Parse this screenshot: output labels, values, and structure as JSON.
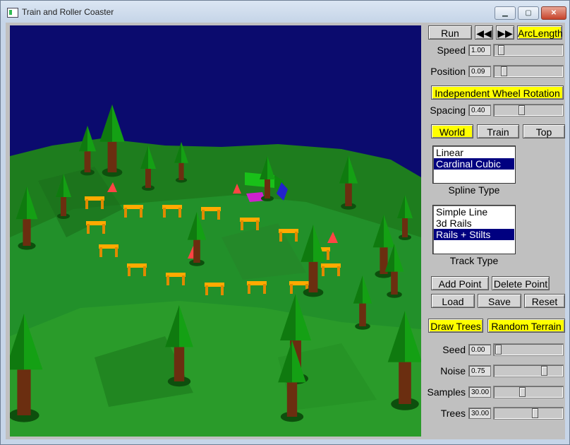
{
  "window": {
    "title": "Train and Roller Coaster",
    "minimize": "▁",
    "maximize": "▢",
    "close": "✕"
  },
  "controls": {
    "run": "Run",
    "rewind": "◀◀",
    "forward": "▶▶",
    "arclength": "ArcLength",
    "speed": {
      "label": "Speed",
      "value": "1.00",
      "fraction": 0.05
    },
    "position": {
      "label": "Position",
      "value": "0.09",
      "fraction": 0.09
    },
    "wheel": "Independent Wheel Rotation",
    "spacing": {
      "label": "Spacing",
      "value": "0.40",
      "fraction": 0.38
    },
    "views": [
      "World",
      "Train",
      "Top"
    ],
    "spline": {
      "options": [
        "Linear",
        "Cardinal Cubic"
      ],
      "selected": 1,
      "caption": "Spline Type"
    },
    "track": {
      "options": [
        "Simple Line",
        "3d Rails",
        "Rails + Stilts"
      ],
      "selected": 2,
      "caption": "Track Type"
    },
    "add_point": "Add Point",
    "delete_point": "Delete Point",
    "load": "Load",
    "save": "Save",
    "reset": "Reset",
    "draw_trees": "Draw Trees",
    "random_terrain": "Random Terrain",
    "seed": {
      "label": "Seed",
      "value": "0.00",
      "fraction": 0.0
    },
    "noise": {
      "label": "Noise",
      "value": "0.75",
      "fraction": 0.75
    },
    "samples": {
      "label": "Samples",
      "value": "30.00",
      "fraction": 0.4
    },
    "trees": {
      "label": "Trees",
      "value": "30.00",
      "fraction": 0.6
    }
  },
  "colors": {
    "active": "#ffff00",
    "sky": "#0b0b6e",
    "grass": "#1f8a1f",
    "rail": "#ffaa00",
    "tree_top": "#14a014",
    "trunk": "#6b2e10"
  }
}
